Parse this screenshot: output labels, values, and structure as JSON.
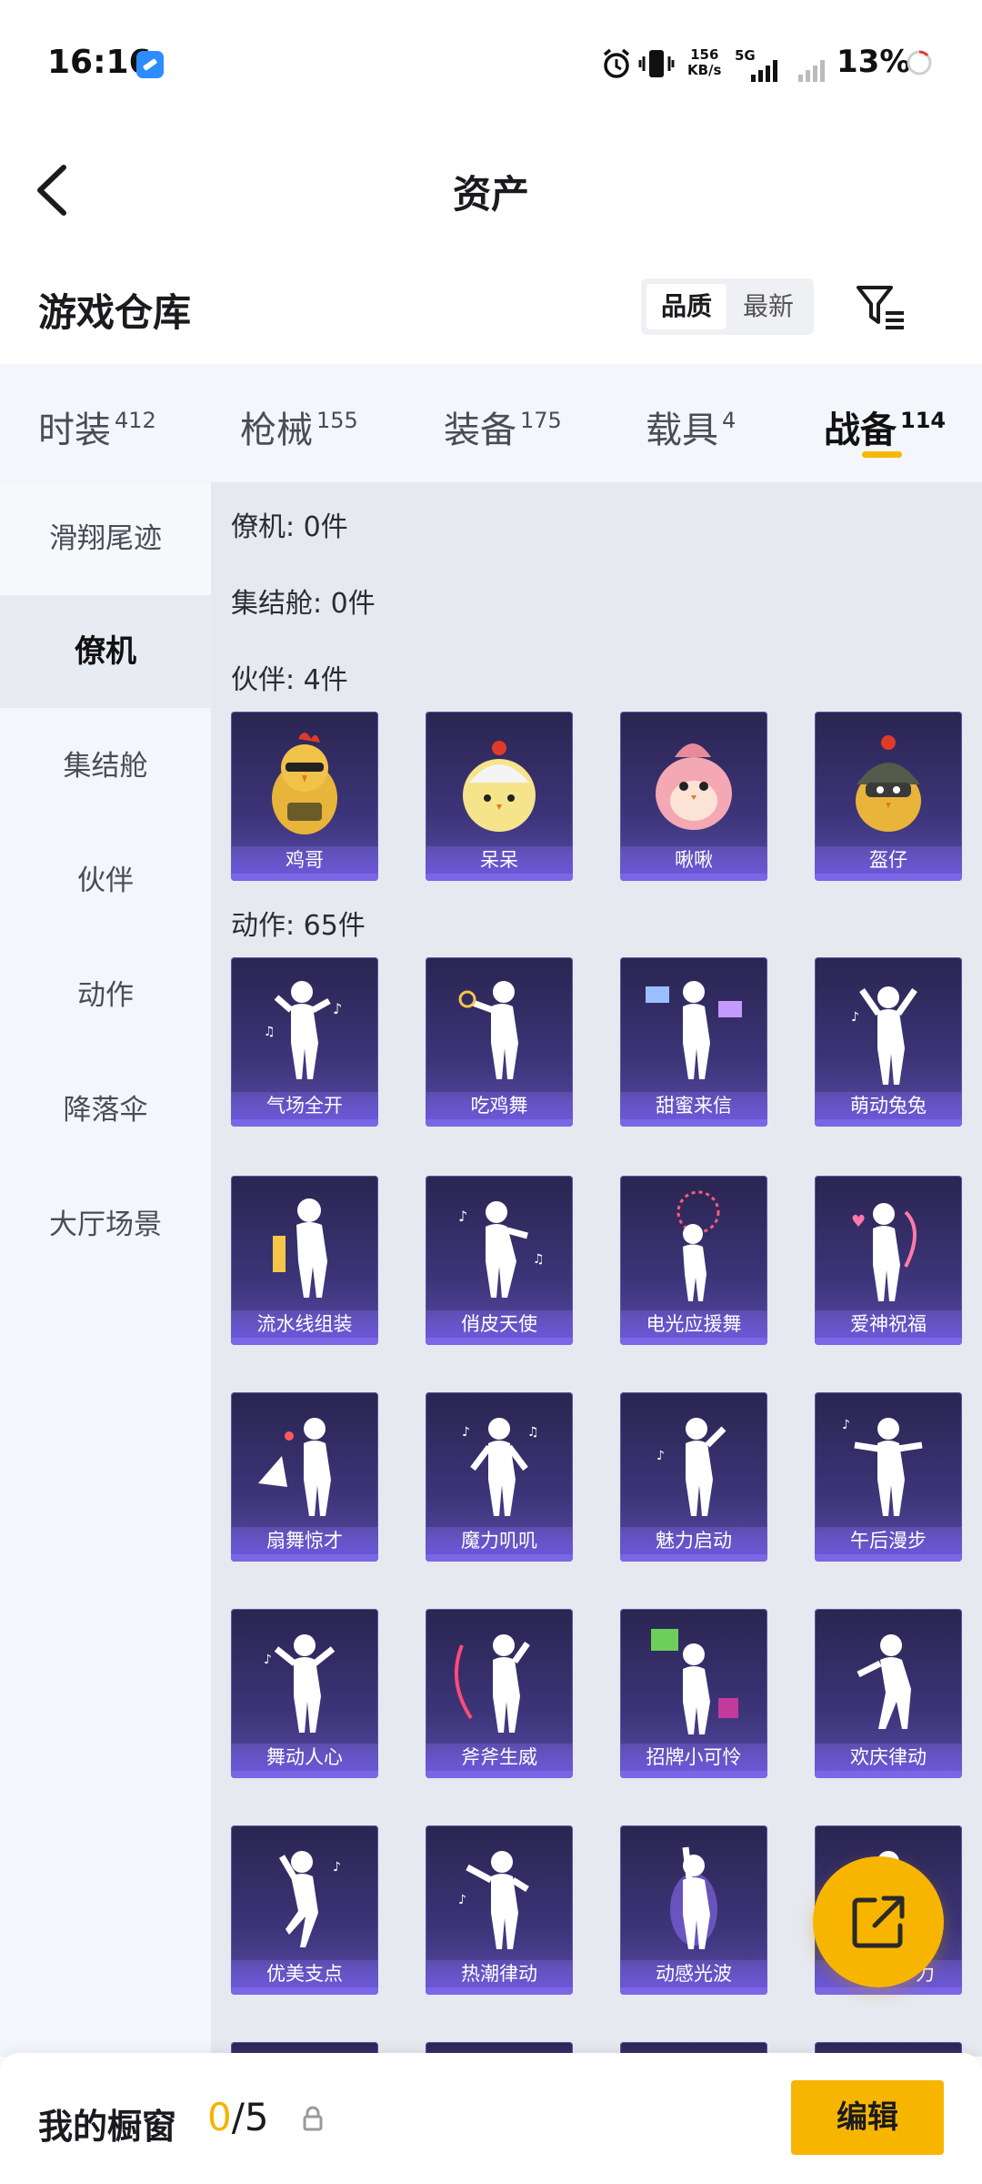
{
  "status_bar": {
    "time": "16:16",
    "net_speed_value": "156",
    "net_speed_unit": "KB/s",
    "network": "5G",
    "battery": "13%"
  },
  "header": {
    "title": "资产",
    "back_icon": "chevron-left-icon"
  },
  "warehouse": {
    "title": "游戏仓库",
    "sort_options": [
      "品质",
      "最新"
    ],
    "sort_selected": "品质",
    "filter_icon": "filter-icon"
  },
  "category_tabs": [
    {
      "label": "时装",
      "count": "412"
    },
    {
      "label": "枪械",
      "count": "155"
    },
    {
      "label": "装备",
      "count": "175"
    },
    {
      "label": "载具",
      "count": "4"
    },
    {
      "label": "战备",
      "count": "114"
    }
  ],
  "active_category": "战备",
  "sidebar": {
    "items": [
      "滑翔尾迹",
      "僚机",
      "集结舱",
      "伙伴",
      "动作",
      "降落伞",
      "大厅场景"
    ],
    "selected": "僚机"
  },
  "sections": {
    "wingman": "僚机: 0件",
    "capsule": "集结舱: 0件",
    "partner": "伙伴: 4件",
    "emote": "动作: 65件"
  },
  "partners": [
    "鸡哥",
    "呆呆",
    "啾啾",
    "盔仔"
  ],
  "emotes": [
    [
      "气场全开",
      "吃鸡舞",
      "甜蜜来信",
      "萌动兔兔"
    ],
    [
      "流水线组装",
      "俏皮天使",
      "电光应援舞",
      "爱神祝福"
    ],
    [
      "扇舞惊才",
      "魔力叽叽",
      "魅力启动",
      "午后漫步"
    ],
    [
      "舞动人心",
      "斧斧生威",
      "招牌小可怜",
      "欢庆律动"
    ],
    [
      "优美支点",
      "热潮律动",
      "动感光波",
      "力"
    ]
  ],
  "bottom_bar": {
    "showcase_label": "我的橱窗",
    "showcase_current": "0",
    "showcase_total": "/5",
    "edit_label": "编辑"
  },
  "colors": {
    "accent": "#f7b500",
    "card_bg": "#3c3478",
    "sidebar_bg": "#f3f6fb"
  }
}
